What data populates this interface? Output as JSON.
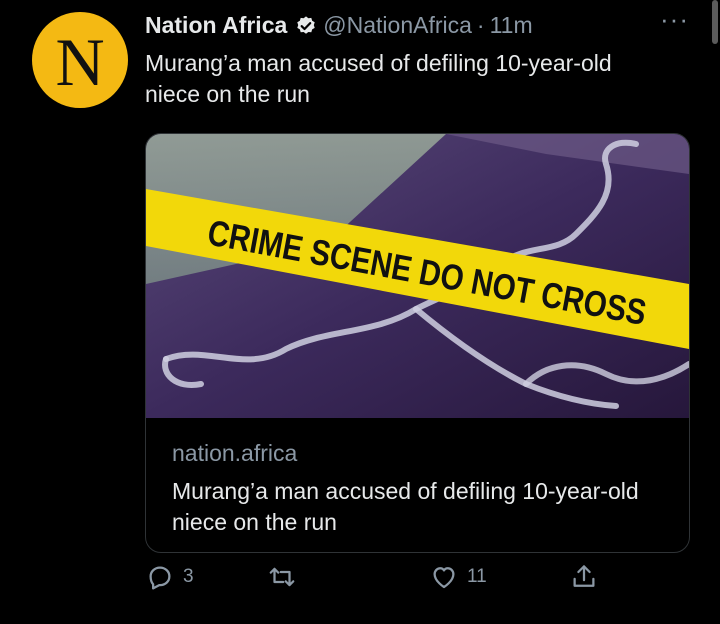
{
  "tweet": {
    "author_name": "Nation Africa",
    "handle": "@NationAfrica",
    "separator": "·",
    "time": "11m",
    "avatar_letter": "N",
    "more_label": "···",
    "text": "Murang’a man accused of defiling 10-year-old niece on the run"
  },
  "card": {
    "image_text": "CRIME SCENE DO NOT CROSS",
    "domain": "nation.africa",
    "title": "Murang’a man accused of defiling 10-year-old niece on the run"
  },
  "actions": {
    "reply_count": "3",
    "retweet_count": "",
    "like_count": "11"
  },
  "colors": {
    "background": "#000000",
    "avatar": "#f4b913",
    "muted_text": "#8b98a5",
    "tape": "#f2d80a"
  },
  "icons": [
    "verified-badge-icon",
    "more-icon",
    "reply-icon",
    "retweet-icon",
    "like-icon",
    "share-icon"
  ]
}
